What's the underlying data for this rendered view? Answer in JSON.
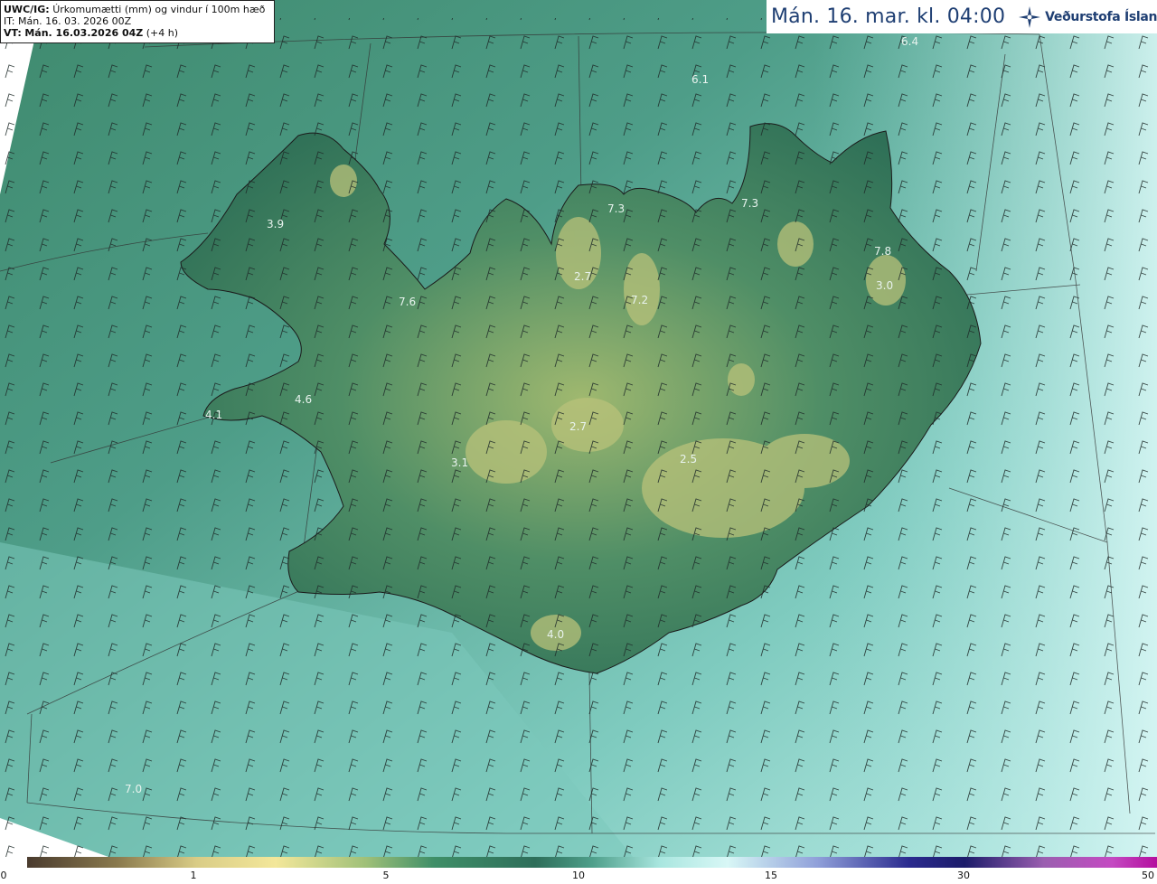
{
  "header": {
    "product_code": "UWC/IG:",
    "product_desc": "Úrkomumætti (mm) og vindur í 100m hæð",
    "init_time": "IT: Mán. 16. 03. 2026 00Z",
    "valid_prefix": "VT:",
    "valid_time": "Mán. 16.03.2026 04Z",
    "lead": "(+4 h)"
  },
  "timestamp": "Mán. 16. mar. kl. 04:00",
  "brand": {
    "name": "Veðurstofa Íslands",
    "icon": "snowflake-star-icon"
  },
  "map_labels": [
    "6.4",
    "6.1",
    "3.9",
    "7.3",
    "7.3",
    "7.6",
    "2.7",
    "7.2",
    "7.8",
    "3.0",
    "4.6",
    "4.1",
    "2.7",
    "3.1",
    "2.5",
    "4.0",
    "7.0"
  ],
  "colorbar": {
    "ticks": [
      "0",
      "1",
      "5",
      "10",
      "15",
      "30",
      "50"
    ],
    "colors": [
      "#4a3b2e",
      "#8a7a4e",
      "#d9cc86",
      "#f3e79a",
      "#9fc078",
      "#3f8f68",
      "#2e6e5a",
      "#4e9f8a",
      "#a9e6df",
      "#d8f7f6",
      "#8f9fd9",
      "#2b2b8f",
      "#1c1c6a",
      "#9b5fb0",
      "#c44ac2",
      "#b40f9e"
    ],
    "units": "mm"
  }
}
